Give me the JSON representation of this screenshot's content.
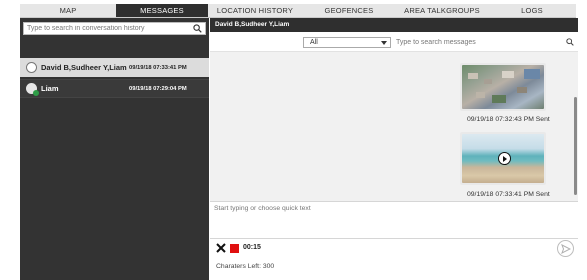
{
  "nav": {
    "tabs": [
      {
        "label": "MAP",
        "active": false
      },
      {
        "label": "MESSAGES",
        "active": true
      },
      {
        "label": "LOCATION HISTORY",
        "active": false
      },
      {
        "label": "GEOFENCES",
        "active": false
      },
      {
        "label": "AREA TALKGROUPS",
        "active": false
      },
      {
        "label": "LOGS",
        "active": false
      }
    ]
  },
  "sidebar": {
    "search": {
      "placeholder": "Type to search in conversation history",
      "icon": "search-icon"
    },
    "conversations": [
      {
        "name": "David B,Sudheer Y,Liam",
        "time": "09/19/18 07:33:41 PM",
        "selected": true,
        "icon": "group-avatar-icon"
      },
      {
        "name": "Liam",
        "time": "09/19/18 07:29:04 PM",
        "selected": false,
        "icon": "user-avatar-icon",
        "status_color": "#2e9d47"
      }
    ]
  },
  "chat": {
    "header_title": "David B,Sudheer Y,Liam",
    "filter": {
      "selected": "All"
    },
    "search": {
      "placeholder": "Type to search messages",
      "icon": "search-icon"
    },
    "messages": [
      {
        "type": "image",
        "timestamp": "09/19/18 07:32:43 PM Sent"
      },
      {
        "type": "video",
        "timestamp": "09/19/18 07:33:41 PM Sent"
      }
    ],
    "compose_placeholder": "Start typing or choose quick text",
    "recording": {
      "timer": "00:15",
      "stop_color": "#e01010"
    },
    "chars_left": "Charaters Left: 300"
  }
}
